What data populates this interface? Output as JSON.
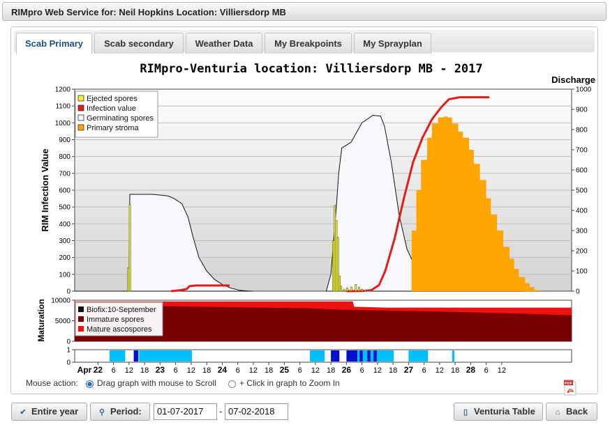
{
  "window": {
    "title": "RIMpro Web Service for: Neil Hopkins Location: Villiersdorp MB"
  },
  "tabs": [
    {
      "label": "Scab Primary",
      "active": true
    },
    {
      "label": "Scab secondary",
      "active": false
    },
    {
      "label": "Weather Data",
      "active": false
    },
    {
      "label": "My Breakpoints",
      "active": false
    },
    {
      "label": "My Sprayplan",
      "active": false
    }
  ],
  "chart_data": {
    "type": "area",
    "title": "RIMpro-Venturia location:  Villiersdorp MB - 2017",
    "ylabel": "RIM Infection Value",
    "y2label": "Discharge",
    "ylim": [
      0,
      1200
    ],
    "y2lim": [
      0,
      1000
    ],
    "yticks": [
      0,
      100,
      200,
      300,
      400,
      500,
      600,
      700,
      800,
      900,
      1000,
      1100,
      1200
    ],
    "y2ticks": [
      0,
      100,
      200,
      300,
      400,
      500,
      600,
      700,
      800,
      900,
      1000
    ],
    "legend": [
      "Ejected spores",
      "Infection value",
      "Germinating spores",
      "Primary stroma"
    ],
    "legend_colors": [
      "#f2f226",
      "#e31b1b",
      "#f7f7fc",
      "#ffa500"
    ],
    "legend_position": "top-left",
    "xaxis": {
      "month_label": "Apr",
      "tick_labels": [
        "22",
        "6",
        "12",
        "18",
        "23",
        "6",
        "12",
        "18",
        "24",
        "6",
        "12",
        "18",
        "25",
        "6",
        "12",
        "18",
        "26",
        "6",
        "12",
        "18",
        "27",
        "6",
        "12",
        "18",
        "28",
        "6",
        "12"
      ],
      "bold_labels": [
        "22",
        "23",
        "24",
        "25",
        "26",
        "27",
        "28"
      ]
    },
    "germinating_spores": {
      "t": [
        0,
        3.5,
        3.55,
        4.5,
        5.0,
        5.6,
        6.05,
        6.4,
        6.9,
        7.3,
        7.6,
        8.0,
        8.5,
        9.0,
        9.5,
        10.0,
        10.6,
        11.0,
        11.43,
        11.5
      ],
      "values": [
        0,
        0,
        575,
        575,
        575,
        570,
        565,
        550,
        520,
        440,
        330,
        200,
        120,
        70,
        40,
        20,
        5,
        2,
        0,
        0
      ]
    },
    "germinating_spores_2": {
      "t": [
        16.2,
        16.5,
        16.85,
        17.0,
        17.2,
        17.8,
        18.5,
        19.2,
        19.7,
        19.95,
        20.4,
        20.9,
        21.4,
        22.0,
        22.5,
        23.0,
        23.5,
        24.0,
        25.0,
        26.0,
        27.0,
        27.5,
        28.0,
        28.5,
        29.0
      ],
      "values": [
        0,
        100,
        500,
        700,
        850,
        885,
        1000,
        1045,
        1040,
        980,
        760,
        450,
        250,
        130,
        60,
        25,
        20,
        18,
        15,
        12,
        8,
        6,
        3,
        1,
        0
      ]
    },
    "primary_stroma": {
      "t": [
        21.3,
        21.7,
        22.0,
        22.3,
        22.7,
        23.0,
        23.4,
        23.8,
        24.0,
        24.3,
        24.7,
        25.0,
        25.4,
        25.7,
        26.1,
        26.5,
        26.8,
        27.2,
        27.6,
        28.0,
        28.3,
        28.6,
        29.0,
        29.3,
        29.6,
        30.0
      ],
      "values": [
        0,
        300,
        500,
        650,
        760,
        830,
        860,
        865,
        860,
        830,
        790,
        760,
        700,
        630,
        550,
        460,
        380,
        300,
        220,
        160,
        110,
        70,
        40,
        20,
        5,
        0
      ]
    },
    "infection_value": {
      "t": [
        6.2,
        6.8,
        7.2,
        7.4,
        7.8,
        8.5,
        9.0,
        9.5,
        9.98,
        17.5,
        18.5,
        19.1,
        19.6,
        20.0,
        20.6,
        21.2,
        21.8,
        22.4,
        23.0,
        23.6,
        24.1,
        24.8,
        25.3,
        25.8,
        26.3,
        26.7
      ],
      "values": [
        0,
        5,
        10,
        25,
        28,
        28,
        28,
        28,
        28,
        0,
        1,
        5,
        30,
        100,
        260,
        460,
        640,
        760,
        850,
        910,
        950,
        960,
        960,
        960,
        960,
        960
      ]
    },
    "ejected_spores": {
      "t": [
        3.45,
        3.55,
        16.65,
        16.75,
        16.85,
        16.95,
        17.05,
        17.15,
        17.35,
        17.55,
        17.8,
        18.1,
        18.3,
        18.5,
        18.7,
        18.95
      ],
      "values": [
        140,
        515,
        300,
        510,
        420,
        320,
        90,
        30,
        12,
        20,
        25,
        40,
        25,
        12,
        8,
        4
      ]
    },
    "maturation": {
      "ylabel": "Maturation",
      "ylim": [
        0,
        10000
      ],
      "yticks": [
        0,
        5000,
        10000
      ],
      "legend": [
        "Biofix:10-September",
        "Immature spores",
        "Mature ascospores"
      ],
      "legend_colors": [
        "#111111",
        "#7a0000",
        "#ee1111"
      ],
      "immature": {
        "t": [
          0,
          5,
          10,
          15,
          17,
          20,
          25,
          30,
          32
        ],
        "values": [
          8700,
          8600,
          8300,
          8050,
          7700,
          7500,
          7100,
          6600,
          6300
        ]
      },
      "mature_top": {
        "t": [
          0,
          17.9,
          18,
          20,
          32
        ],
        "values": [
          9700,
          9700,
          8400,
          8200,
          8200
        ]
      }
    },
    "wetness_band": {
      "ylim": [
        0,
        1
      ],
      "yticks": [
        0,
        1
      ],
      "light_color": "#00bfff",
      "dark_color": "#0011cc",
      "light_intervals": [
        [
          2.25,
          3.25
        ],
        [
          4.15,
          7.55
        ],
        [
          15.15,
          16.1
        ],
        [
          18.2,
          20.55
        ],
        [
          21.5,
          22.75
        ],
        [
          24.3,
          24.45
        ]
      ],
      "dark_intervals": [
        [
          3.8,
          4.1
        ],
        [
          16.5,
          17.05
        ],
        [
          17.5,
          18.2
        ],
        [
          18.35,
          18.55
        ],
        [
          18.85,
          19.05
        ],
        [
          19.25,
          19.45
        ]
      ]
    }
  },
  "mouse_action": {
    "label": "Mouse action:",
    "option_scroll": "Drag graph with mouse to Scroll",
    "option_zoom": "+ Click in graph to Zoom In",
    "selected": "scroll"
  },
  "pdf": {
    "badge": "PDF"
  },
  "footer": {
    "entire_year": "Entire year",
    "period": "Period:",
    "date_from": "01-07-2017",
    "date_sep": "-",
    "date_to": "07-02-2018",
    "venturia_table": "Venturia Table",
    "back": "Back"
  }
}
